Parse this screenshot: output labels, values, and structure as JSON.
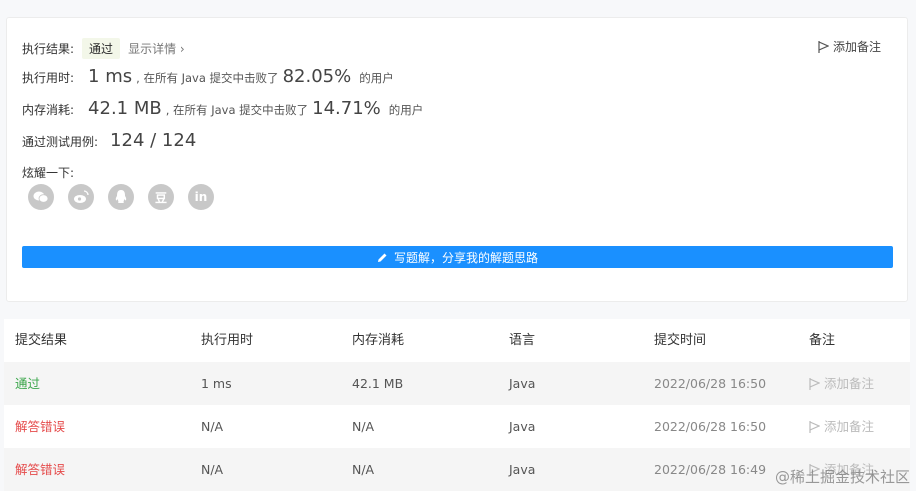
{
  "result": {
    "label": "执行结果:",
    "status": "通过",
    "detail": "显示详情",
    "add_note": "添加备注"
  },
  "runtime": {
    "label": "执行用时:",
    "value": "1 ms",
    "mid": ", 在所有 Java 提交中击败了",
    "pct": "82.05%",
    "tail": "的用户"
  },
  "memory": {
    "label": "内存消耗:",
    "value": "42.1 MB",
    "mid": ", 在所有 Java 提交中击败了",
    "pct": "14.71%",
    "tail": "的用户"
  },
  "tests": {
    "label": "通过测试用例:",
    "value": "124 / 124"
  },
  "share": {
    "label": "炫耀一下:",
    "icons": [
      "wechat-icon",
      "weibo-icon",
      "qq-icon",
      "douban-icon",
      "linkedin-icon"
    ],
    "douban_glyph": "豆",
    "linkedin_glyph": "in"
  },
  "solution_button": "写题解，分享我的解题思路",
  "table": {
    "headers": [
      "提交结果",
      "执行用时",
      "内存消耗",
      "语言",
      "提交时间",
      "备注"
    ],
    "rows": [
      {
        "result": "通过",
        "time": "1 ms",
        "memory": "42.1 MB",
        "lang": "Java",
        "date": "2022/06/28 16:50",
        "note": "添加备注"
      },
      {
        "result": "解答错误",
        "time": "N/A",
        "memory": "N/A",
        "lang": "Java",
        "date": "2022/06/28 16:50",
        "note": "添加备注"
      },
      {
        "result": "解答错误",
        "time": "N/A",
        "memory": "N/A",
        "lang": "Java",
        "date": "2022/06/28 16:49",
        "note": "添加备注"
      }
    ]
  },
  "watermark": "@稀土掘金技术社区",
  "colors": {
    "accent": "#1a90ff",
    "success": "#3aa64a",
    "error": "#e54b4b"
  }
}
